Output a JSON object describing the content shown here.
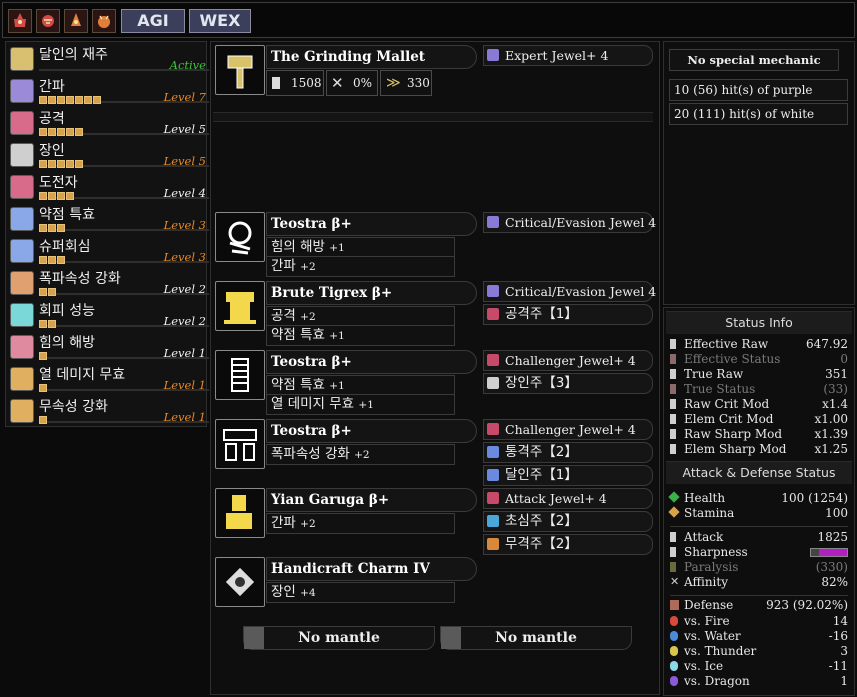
{
  "tags": [
    "AGI",
    "WEX"
  ],
  "foods": [
    "food-icon-1",
    "food-icon-2",
    "food-icon-3",
    "food-icon-4"
  ],
  "skills": [
    {
      "name": "달인의 재주",
      "level": "Active",
      "pips": 0,
      "color": "active",
      "icon_color": "#d8c070"
    },
    {
      "name": "간파",
      "level": "Level 7",
      "pips": 7,
      "color": "orange",
      "icon_color": "#9a8ad8"
    },
    {
      "name": "공격",
      "level": "Level 5",
      "pips": 5,
      "color": "white",
      "icon_color": "#d86a8a"
    },
    {
      "name": "장인",
      "level": "Level 5",
      "pips": 5,
      "color": "orange",
      "icon_color": "#cfcfcf"
    },
    {
      "name": "도전자",
      "level": "Level 4",
      "pips": 4,
      "color": "white",
      "icon_color": "#d86a8a"
    },
    {
      "name": "약점 특효",
      "level": "Level 3",
      "pips": 3,
      "color": "orange",
      "icon_color": "#8aa8e8"
    },
    {
      "name": "슈퍼회심",
      "level": "Level 3",
      "pips": 3,
      "color": "orange",
      "icon_color": "#8aa8e8"
    },
    {
      "name": "폭파속성 강화",
      "level": "Level 2",
      "pips": 2,
      "color": "white",
      "icon_color": "#e0a070"
    },
    {
      "name": "회피 성능",
      "level": "Level 2",
      "pips": 2,
      "color": "white",
      "icon_color": "#7ad8d8"
    },
    {
      "name": "힘의 해방",
      "level": "Level 1",
      "pips": 1,
      "color": "white",
      "icon_color": "#e08aa0"
    },
    {
      "name": "열 데미지 무효",
      "level": "Level 1",
      "pips": 1,
      "color": "orange",
      "icon_color": "#e0b060"
    },
    {
      "name": "무속성 강화",
      "level": "Level 1",
      "pips": 1,
      "color": "orange",
      "icon_color": "#e0b060"
    }
  ],
  "weapon": {
    "name": "The Grinding Mallet",
    "attack": "1508",
    "affinity": "0%",
    "element": "330",
    "deco": "Expert Jewel+ 4"
  },
  "armor": [
    {
      "name": "Teostra β+",
      "skills": [
        {
          "name": "힘의 해방",
          "lv": "+1"
        },
        {
          "name": "간파",
          "lv": "+2"
        }
      ],
      "decos": [
        {
          "label": "Critical/Evasion Jewel 4",
          "k": false,
          "color": "#8a7ad8"
        }
      ]
    },
    {
      "name": "Brute Tigrex β+",
      "skills": [
        {
          "name": "공격",
          "lv": "+2"
        },
        {
          "name": "약점 특효",
          "lv": "+1"
        }
      ],
      "decos": [
        {
          "label": "Critical/Evasion Jewel 4",
          "k": false,
          "color": "#8a7ad8"
        },
        {
          "label": "공격주【1】",
          "k": true,
          "color": "#c84a6a"
        }
      ]
    },
    {
      "name": "Teostra β+",
      "skills": [
        {
          "name": "약점 특효",
          "lv": "+1"
        },
        {
          "name": "열 데미지 무효",
          "lv": "+1"
        }
      ],
      "decos": [
        {
          "label": "Challenger Jewel+ 4",
          "k": false,
          "color": "#c84a6a"
        },
        {
          "label": "장인주【3】",
          "k": true,
          "color": "#cfcfcf"
        }
      ]
    },
    {
      "name": "Teostra β+",
      "skills": [
        {
          "name": "폭파속성 강화",
          "lv": "+2"
        }
      ],
      "decos": [
        {
          "label": "Challenger Jewel+ 4",
          "k": false,
          "color": "#c84a6a"
        },
        {
          "label": "통격주【2】",
          "k": true,
          "color": "#6a8ae0"
        },
        {
          "label": "달인주【1】",
          "k": true,
          "color": "#6a8ae0"
        }
      ]
    },
    {
      "name": "Yian Garuga β+",
      "skills": [
        {
          "name": "간파",
          "lv": "+2"
        }
      ],
      "decos": [
        {
          "label": "Attack Jewel+ 4",
          "k": false,
          "color": "#c84a6a"
        },
        {
          "label": "초심주【2】",
          "k": true,
          "color": "#4aa8d8"
        },
        {
          "label": "무격주【2】",
          "k": true,
          "color": "#d88a3a"
        }
      ]
    },
    {
      "name": "Handicraft Charm IV",
      "skills": [
        {
          "name": "장인",
          "lv": "+4"
        }
      ],
      "decos": []
    }
  ],
  "mantles": [
    "No mantle",
    "No mantle"
  ],
  "mechanic": {
    "title": "No special mechanic",
    "lines": [
      "10 (56) hit(s) of purple",
      "20 (111) hit(s) of white"
    ]
  },
  "status": {
    "header": "Status Info",
    "rows": [
      {
        "label": "Effective Raw",
        "value": "647.92",
        "dim": false,
        "icon": "#cfcfcf"
      },
      {
        "label": "Effective Status",
        "value": "0",
        "dim": true,
        "icon": "#8a6a6a"
      },
      {
        "label": "True Raw",
        "value": "351",
        "dim": false,
        "icon": "#cfcfcf"
      },
      {
        "label": "True Status",
        "value": "(33)",
        "dim": true,
        "icon": "#8a6a6a"
      },
      {
        "label": "Raw Crit Mod",
        "value": "x1.4",
        "dim": false,
        "icon": "#cfcfcf"
      },
      {
        "label": "Elem Crit Mod",
        "value": "x1.00",
        "dim": false,
        "icon": "#cfcfcf"
      },
      {
        "label": "Raw Sharp Mod",
        "value": "x1.39",
        "dim": false,
        "icon": "#cfcfcf"
      },
      {
        "label": "Elem Sharp Mod",
        "value": "x1.25",
        "dim": false,
        "icon": "#cfcfcf"
      }
    ]
  },
  "attack_defense": {
    "header": "Attack & Defense Status",
    "health": {
      "label": "Health",
      "value": "100 (1254)"
    },
    "stamina": {
      "label": "Stamina",
      "value": "100"
    },
    "attack": {
      "label": "Attack",
      "value": "1825"
    },
    "sharpness": {
      "label": "Sharpness",
      "color": "#b020c0"
    },
    "paralysis": {
      "label": "Paralysis",
      "value": "(330)"
    },
    "affinity": {
      "label": "Affinity",
      "value": "82%"
    },
    "defense": {
      "label": "Defense",
      "value": "923 (92.02%)"
    },
    "res": [
      {
        "label": "vs. Fire",
        "value": "14",
        "icon": "#d84a3a"
      },
      {
        "label": "vs. Water",
        "value": "-16",
        "icon": "#4a8ad8"
      },
      {
        "label": "vs. Thunder",
        "value": "3",
        "icon": "#d8c84a"
      },
      {
        "label": "vs. Ice",
        "value": "-11",
        "icon": "#8ad8e8"
      },
      {
        "label": "vs. Dragon",
        "value": "1",
        "icon": "#8a5ad8"
      }
    ]
  }
}
